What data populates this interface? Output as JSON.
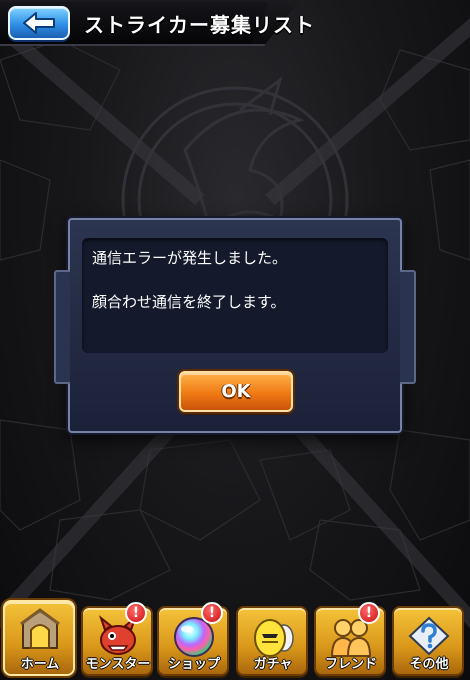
{
  "header": {
    "title": "ストライカー募集リスト",
    "back_icon": "back-arrow-icon"
  },
  "dialog": {
    "message_line1": "通信エラーが発生しました。",
    "message_line2": "顔合わせ通信を終了します。",
    "ok_label": "OK"
  },
  "bottom_nav": {
    "items": [
      {
        "label": "ホーム",
        "icon": "home-icon",
        "badge": ""
      },
      {
        "label": "モンスター",
        "icon": "monster-icon",
        "badge": "!"
      },
      {
        "label": "ショップ",
        "icon": "shop-orb-icon",
        "badge": "!"
      },
      {
        "label": "ガチャ",
        "icon": "gacha-egg-icon",
        "badge": ""
      },
      {
        "label": "フレンド",
        "icon": "friends-icon",
        "badge": "!"
      },
      {
        "label": "その他",
        "icon": "other-icon",
        "badge": ""
      }
    ]
  },
  "colors": {
    "back_button": "#2f8fe6",
    "ok_button": "#f07a14",
    "nav_gold": "#d9971a",
    "dialog_bg": "#1b2138",
    "badge_red": "#c80f0f"
  }
}
